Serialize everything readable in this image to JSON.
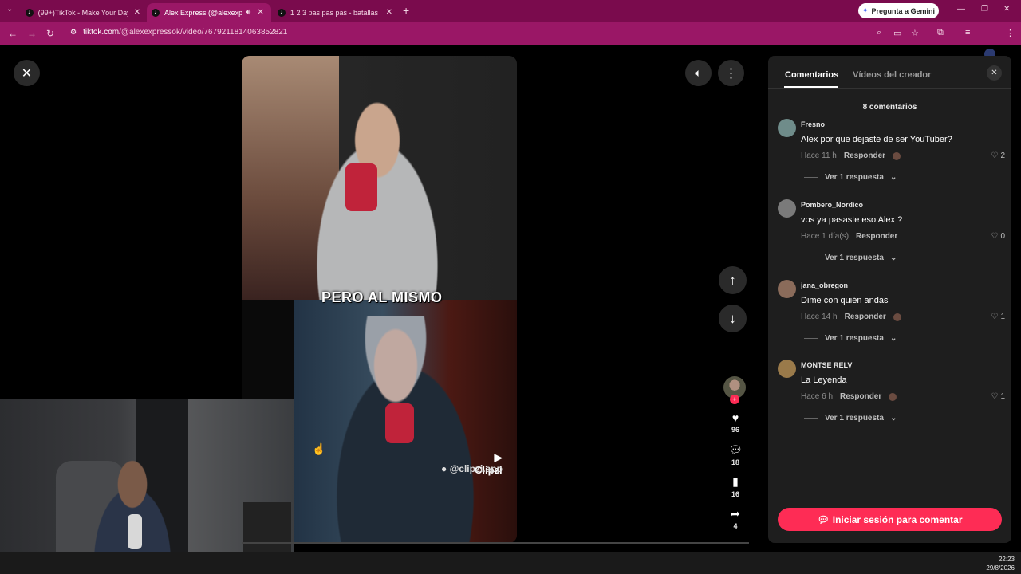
{
  "browser": {
    "tabs": [
      {
        "title": "(99+)TikTok - Make Your Day",
        "active": false
      },
      {
        "title": "Alex Express (@alexexpress",
        "active": true
      },
      {
        "title": "1 2 3 pas pas pas - batallas de",
        "active": false
      }
    ],
    "gemini_label": "Pregunta a Gemini",
    "url": {
      "site": "tiktok.com",
      "path": "/@alexexpressok/video/7679211814063852821"
    }
  },
  "video": {
    "caption": "PERO AL MISMO",
    "watermark": "Clipzi",
    "watermark_handle": "@clipzi.app"
  },
  "actions": {
    "likes": "96",
    "comments": "18",
    "saves": "16",
    "shares": "4"
  },
  "panel": {
    "tab_comments": "Comentarios",
    "tab_creator": "Vídeos del creador",
    "count": "8 comentarios",
    "reply_label": "Responder",
    "view_replies": "Ver 1 respuesta",
    "comments": [
      {
        "user": "Fresno",
        "text": "Alex por que dejaste de ser YouTuber?",
        "time": "Hace 11 h",
        "likes": "2",
        "avatar_color": "#6f8c8a"
      },
      {
        "user": "Pombero_Nordico",
        "text": "vos ya pasaste eso Alex ?",
        "time": "Hace 1 día(s)",
        "likes": "0",
        "avatar_color": "#7a7a7a"
      },
      {
        "user": "jana_obregon",
        "text": "Dime con quién andas",
        "time": "Hace 14 h",
        "likes": "1",
        "avatar_color": "#8a6b5a"
      },
      {
        "user": "MONTSE RELV",
        "text": "La Leyenda",
        "time": "Hace 6 h",
        "likes": "1",
        "avatar_color": "#9a7a4a"
      }
    ],
    "login_button": "Iniciar sesión para comentar"
  },
  "taskbar": {
    "time": "22:23",
    "date": "29/8/2026"
  },
  "colors": {
    "accent": "#fe2c55",
    "browser_frame": "#7a0b4d",
    "address_bar": "#9a1766"
  }
}
